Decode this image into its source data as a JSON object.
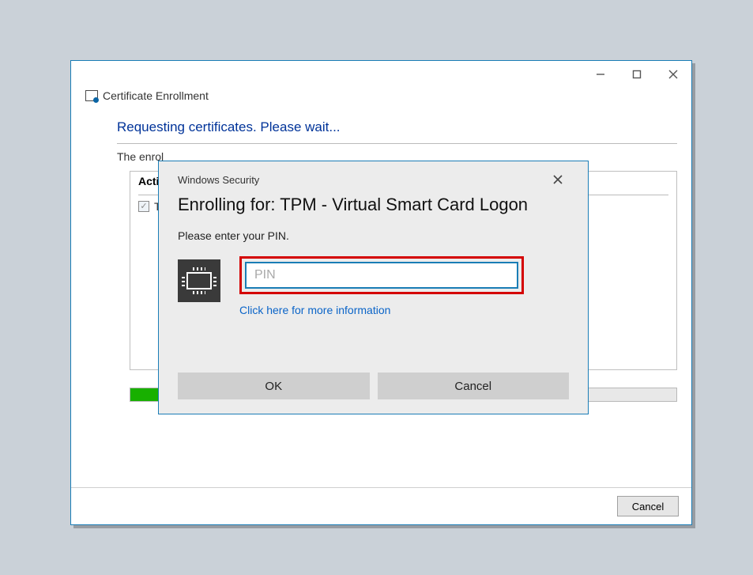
{
  "parent": {
    "title": "Certificate Enrollment",
    "heading": "Requesting certificates. Please wait...",
    "enrollment_text_prefix": "The enrol",
    "panel": {
      "header": "Active",
      "item_prefix": "TPM"
    },
    "progress_percent": 55,
    "cancel_label": "Cancel"
  },
  "modal": {
    "title": "Windows Security",
    "heading": "Enrolling for: TPM - Virtual Smart Card Logon",
    "instruction": "Please enter your PIN.",
    "pin_placeholder": "PIN",
    "pin_value": "",
    "more_info": "Click here for more information",
    "ok_label": "OK",
    "cancel_label": "Cancel"
  },
  "colors": {
    "accent": "#1a7db6",
    "link": "#0a64c8",
    "progress": "#18b000",
    "highlight": "#d40000"
  }
}
